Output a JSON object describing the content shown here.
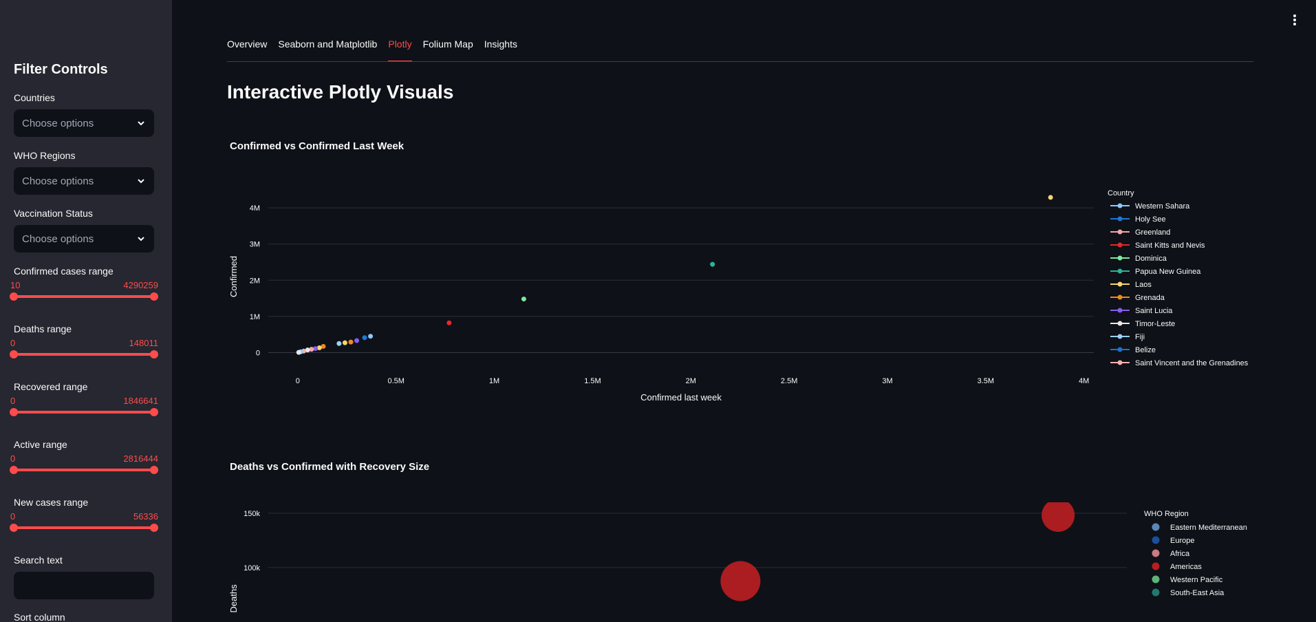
{
  "sidebar": {
    "title": "Filter Controls",
    "countries": {
      "label": "Countries",
      "placeholder": "Choose options"
    },
    "who_regions": {
      "label": "WHO Regions",
      "placeholder": "Choose options"
    },
    "vaccination": {
      "label": "Vaccination Status",
      "placeholder": "Choose options"
    },
    "ranges": [
      {
        "label": "Confirmed cases range",
        "min": "10",
        "max": "4290259"
      },
      {
        "label": "Deaths range",
        "min": "0",
        "max": "148011"
      },
      {
        "label": "Recovered range",
        "min": "0",
        "max": "1846641"
      },
      {
        "label": "Active range",
        "min": "0",
        "max": "2816444"
      },
      {
        "label": "New cases range",
        "min": "0",
        "max": "56336"
      }
    ],
    "search_label": "Search text",
    "sort_label": "Sort column"
  },
  "tabs": [
    {
      "label": "Overview",
      "active": false
    },
    {
      "label": "Seaborn and Matplotlib",
      "active": false
    },
    {
      "label": "Plotly",
      "active": true
    },
    {
      "label": "Folium Map",
      "active": false
    },
    {
      "label": "Insights",
      "active": false
    }
  ],
  "page": {
    "title": "Interactive Plotly Visuals"
  },
  "colors": {
    "accent": "#ff4b4b",
    "background": "#0e1117",
    "sidebar": "#262730"
  },
  "chart_data": [
    {
      "type": "scatter",
      "title": "Confirmed vs Confirmed Last Week",
      "xlabel": "Confirmed last week",
      "ylabel": "Confirmed",
      "xlim": [
        -150000,
        4050000
      ],
      "ylim": [
        -450000,
        4650000
      ],
      "x_ticks": [
        {
          "v": 0,
          "label": "0"
        },
        {
          "v": 500000,
          "label": "0.5M"
        },
        {
          "v": 1000000,
          "label": "1M"
        },
        {
          "v": 1500000,
          "label": "1.5M"
        },
        {
          "v": 2000000,
          "label": "2M"
        },
        {
          "v": 2500000,
          "label": "2.5M"
        },
        {
          "v": 3000000,
          "label": "3M"
        },
        {
          "v": 3500000,
          "label": "3.5M"
        },
        {
          "v": 4000000,
          "label": "4M"
        }
      ],
      "y_ticks": [
        {
          "v": 0,
          "label": "0"
        },
        {
          "v": 1000000,
          "label": "1M"
        },
        {
          "v": 2000000,
          "label": "2M"
        },
        {
          "v": 3000000,
          "label": "3M"
        },
        {
          "v": 4000000,
          "label": "4M"
        }
      ],
      "legend_title": "Country",
      "legend": [
        {
          "name": "Western Sahara",
          "color": "#8cc8ff"
        },
        {
          "name": "Holy See",
          "color": "#1f77d4"
        },
        {
          "name": "Greenland",
          "color": "#f4a6a6"
        },
        {
          "name": "Saint Kitts and Nevis",
          "color": "#e8282a"
        },
        {
          "name": "Dominica",
          "color": "#7de8a0"
        },
        {
          "name": "Papua New Guinea",
          "color": "#2ab59c"
        },
        {
          "name": "Laos",
          "color": "#f5d76e"
        },
        {
          "name": "Grenada",
          "color": "#f0891e"
        },
        {
          "name": "Saint Lucia",
          "color": "#8a5cf0"
        },
        {
          "name": "Timor-Leste",
          "color": "#e8e8e8"
        },
        {
          "name": "Fiji",
          "color": "#9ad0ff"
        },
        {
          "name": "Belize",
          "color": "#1f6fcf"
        },
        {
          "name": "Saint Vincent and the Grenadines",
          "color": "#f7b0b0"
        }
      ],
      "points": [
        {
          "x": 3830000,
          "y": 4290000,
          "color": "#f5d76e"
        },
        {
          "x": 2110000,
          "y": 2440000,
          "color": "#2ab59c"
        },
        {
          "x": 1150000,
          "y": 1480000,
          "color": "#7de8a0"
        },
        {
          "x": 770000,
          "y": 820000,
          "color": "#e8282a"
        },
        {
          "x": 370000,
          "y": 450000,
          "color": "#8cc8ff"
        },
        {
          "x": 340000,
          "y": 410000,
          "color": "#1f77d4"
        },
        {
          "x": 300000,
          "y": 330000,
          "color": "#8a5cf0"
        },
        {
          "x": 270000,
          "y": 290000,
          "color": "#f0891e"
        },
        {
          "x": 240000,
          "y": 270000,
          "color": "#f5d76e"
        },
        {
          "x": 210000,
          "y": 250000,
          "color": "#9ad0ff"
        },
        {
          "x": 130000,
          "y": 170000,
          "color": "#f0891e"
        },
        {
          "x": 110000,
          "y": 130000,
          "color": "#f5d76e"
        },
        {
          "x": 90000,
          "y": 110000,
          "color": "#8a5cf0"
        },
        {
          "x": 70000,
          "y": 90000,
          "color": "#f4a6a6"
        },
        {
          "x": 50000,
          "y": 70000,
          "color": "#e8e8e8"
        },
        {
          "x": 30000,
          "y": 40000,
          "color": "#f7b0b0"
        },
        {
          "x": 15000,
          "y": 20000,
          "color": "#8cc8ff"
        },
        {
          "x": 5000,
          "y": 5000,
          "color": "#e8e8e8"
        }
      ]
    },
    {
      "type": "scatter",
      "title": "Deaths vs Confirmed with Recovery Size",
      "ylabel": "Deaths",
      "ylim": [
        50000,
        160000
      ],
      "xlim": [
        0,
        1
      ],
      "y_ticks": [
        {
          "v": 100000,
          "label": "100k"
        },
        {
          "v": 150000,
          "label": "150k"
        }
      ],
      "legend_title": "WHO Region",
      "legend": [
        {
          "name": "Eastern Mediterranean",
          "color": "#5b86b8"
        },
        {
          "name": "Europe",
          "color": "#1a4f9c"
        },
        {
          "name": "Africa",
          "color": "#c97a82"
        },
        {
          "name": "Americas",
          "color": "#b81e22"
        },
        {
          "name": "Western Pacific",
          "color": "#5fb377"
        },
        {
          "name": "South-East Asia",
          "color": "#1f7a6e"
        }
      ],
      "points": [
        {
          "x": 0.92,
          "y": 148011,
          "r": 24,
          "color": "#b81e22"
        },
        {
          "x": 0.55,
          "y": 87600,
          "r": 29,
          "color": "#b81e22"
        }
      ]
    }
  ]
}
